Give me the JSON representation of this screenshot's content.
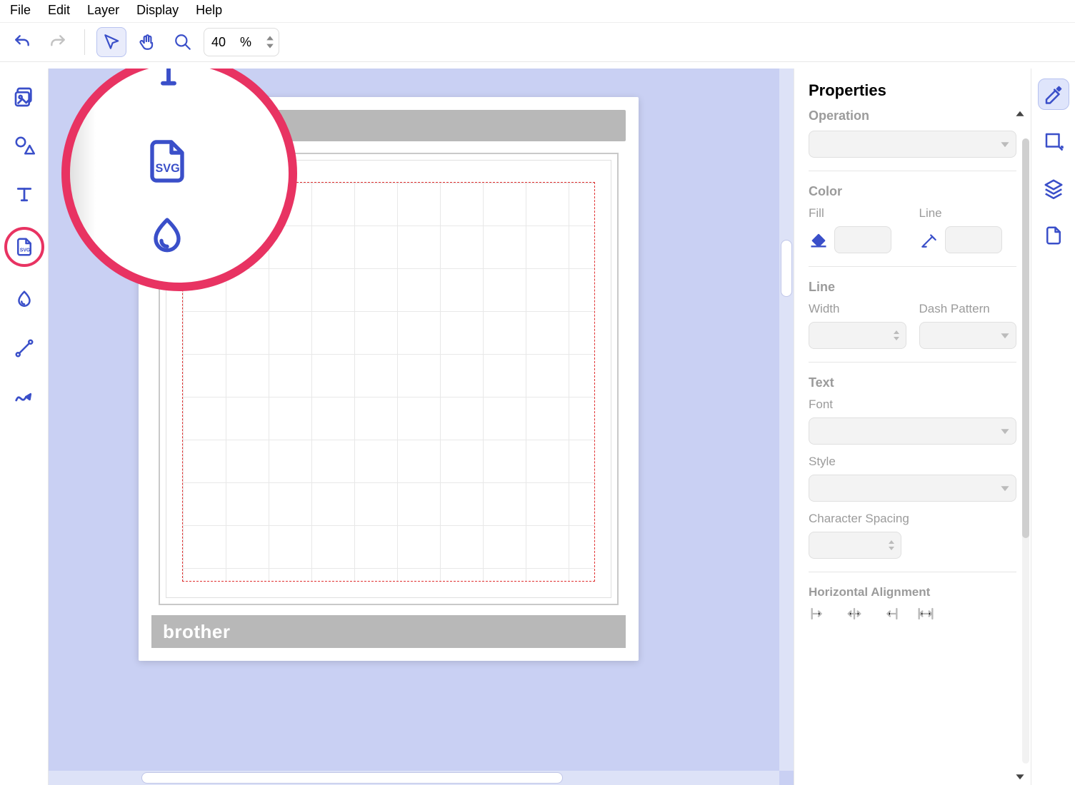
{
  "menu": {
    "file": "File",
    "edit": "Edit",
    "layer": "Layer",
    "display": "Display",
    "help": "Help"
  },
  "toolbar": {
    "zoom_value": "40",
    "zoom_unit": "%"
  },
  "canvas": {
    "brand": "brother"
  },
  "properties": {
    "title": "Properties",
    "operation": "Operation",
    "color": "Color",
    "fill": "Fill",
    "line": "Line",
    "line_section": "Line",
    "width": "Width",
    "dash": "Dash Pattern",
    "text": "Text",
    "font": "Font",
    "style": "Style",
    "char_spacing": "Character Spacing",
    "h_align": "Horizontal Alignment"
  }
}
